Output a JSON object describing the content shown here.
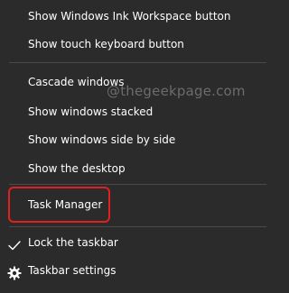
{
  "menu": {
    "items": [
      {
        "label": "Show Windows Ink Workspace button"
      },
      {
        "label": "Show touch keyboard button"
      },
      {
        "label": "Cascade windows"
      },
      {
        "label": "Show windows stacked"
      },
      {
        "label": "Show windows side by side"
      },
      {
        "label": "Show the desktop"
      },
      {
        "label": "Task Manager"
      },
      {
        "label": "Lock the taskbar",
        "checked": true,
        "icon": "check-icon"
      },
      {
        "label": "Taskbar settings",
        "icon": "gear-icon"
      }
    ]
  },
  "watermark": "@thegeekpage.com",
  "colors": {
    "background": "#2b2b2b",
    "text": "#ffffff",
    "separator": "#4a4a4a",
    "highlight_border": "#e02020",
    "watermark": "#6c6c6c"
  }
}
